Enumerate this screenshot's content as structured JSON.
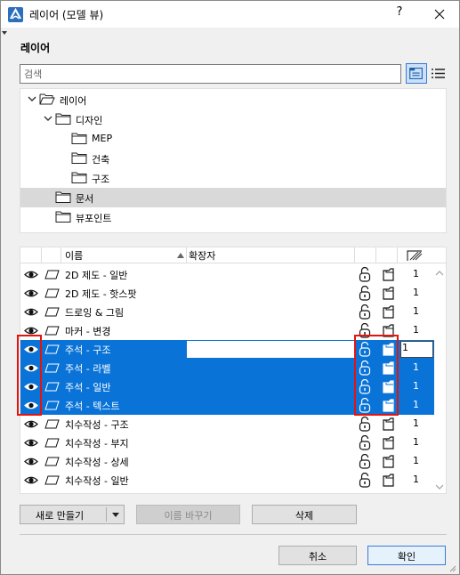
{
  "window": {
    "title": "레이어 (모델 뷰)",
    "help_label": "?",
    "close_icon": "close-icon",
    "app_icon": "archicad-icon"
  },
  "section_title": "레이어",
  "search": {
    "placeholder": "검색",
    "value": ""
  },
  "view_buttons": [
    {
      "icon": "folder-tree-view-icon",
      "active": true
    },
    {
      "icon": "list-view-icon",
      "active": false
    }
  ],
  "tree": [
    {
      "label": "레이어",
      "level": 0,
      "expanded": true,
      "has_children": true,
      "selected": false,
      "open_folder": true
    },
    {
      "label": "디자인",
      "level": 1,
      "expanded": true,
      "has_children": true,
      "selected": false
    },
    {
      "label": "MEP",
      "level": 2,
      "has_children": false,
      "selected": false
    },
    {
      "label": "건축",
      "level": 2,
      "has_children": false,
      "selected": false
    },
    {
      "label": "구조",
      "level": 2,
      "has_children": false,
      "selected": false
    },
    {
      "label": "문서",
      "level": 1,
      "has_children": false,
      "selected": true
    },
    {
      "label": "뷰포인트",
      "level": 1,
      "has_children": false,
      "selected": false
    }
  ],
  "table": {
    "headers": {
      "name": "이름",
      "extension": "확장자",
      "sort_icon": "sort-ascending-icon",
      "pen_icon": "hatch-pen-icon"
    },
    "rows": [
      {
        "name": "2D 제도 - 일반",
        "num": "1",
        "selected": false
      },
      {
        "name": "2D 제도 - 핫스팟",
        "num": "1",
        "selected": false
      },
      {
        "name": "드로잉 & 그림",
        "num": "1",
        "selected": false
      },
      {
        "name": "마커 - 변경",
        "num": "1",
        "selected": false
      },
      {
        "name": "주석 - 구조",
        "num": "1",
        "selected": true,
        "editing": true
      },
      {
        "name": "주석 - 라벨",
        "num": "1",
        "selected": true
      },
      {
        "name": "주석 - 일반",
        "num": "1",
        "selected": true
      },
      {
        "name": "주석 - 텍스트",
        "num": "1",
        "selected": true
      },
      {
        "name": "치수작성 - 구조",
        "num": "1",
        "selected": false
      },
      {
        "name": "치수작성 - 부지",
        "num": "1",
        "selected": false
      },
      {
        "name": "치수작성 - 상세",
        "num": "1",
        "selected": false
      },
      {
        "name": "치수작성 - 일반",
        "num": "1",
        "selected": false
      }
    ]
  },
  "buttons": {
    "new": "새로 만들기",
    "rename": "이름 바꾸기",
    "delete": "삭제",
    "cancel": "취소",
    "ok": "확인"
  },
  "colors": {
    "selection": "#0a73d8",
    "highlight_box": "#e3140f",
    "tree_selected": "#d9d9d9"
  }
}
